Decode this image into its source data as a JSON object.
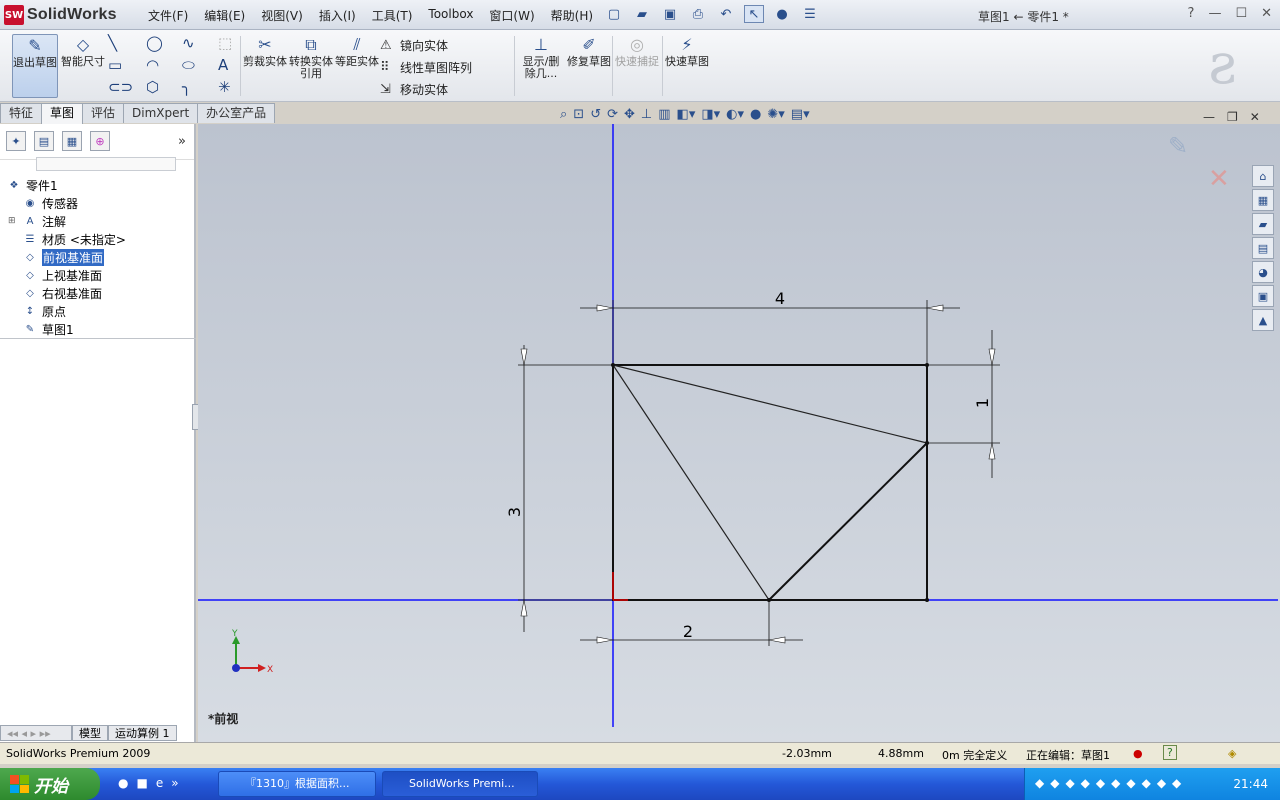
{
  "app": {
    "logo_text": "SolidWorks",
    "doc_title": "草图1 ← 零件1 *"
  },
  "menus": [
    "文件(F)",
    "编辑(E)",
    "视图(V)",
    "插入(I)",
    "工具(T)",
    "Toolbox",
    "窗口(W)",
    "帮助(H)"
  ],
  "title_right": {
    "help": "?",
    "minimize": "—",
    "restore": "☐",
    "close": "✕"
  },
  "commands": {
    "exit_sketch": "退出草图",
    "smart_dim": "智能尺寸",
    "trim": "剪裁实体",
    "convert": "转换实体引用",
    "offset": "等距实体",
    "mirror": "镜向实体",
    "linear_pattern": "线性草图阵列",
    "move": "移动实体",
    "show_delete": "显示/删除几...",
    "repair": "修复草图",
    "quick_snap": "快速捕捉",
    "rapid_sketch": "快速草图"
  },
  "tabs": [
    "特征",
    "草图",
    "评估",
    "DimXpert",
    "办公室产品"
  ],
  "active_tab": "草图",
  "tree": [
    {
      "label": "零件1",
      "icon": "part-icon"
    },
    {
      "label": "传感器",
      "icon": "sensor-icon"
    },
    {
      "label": "注解",
      "icon": "annotation-icon"
    },
    {
      "label": "材质 <未指定>",
      "icon": "material-icon"
    },
    {
      "label": "前视基准面",
      "icon": "plane-icon",
      "selected": true
    },
    {
      "label": "上视基准面",
      "icon": "plane-icon"
    },
    {
      "label": "右视基准面",
      "icon": "plane-icon"
    },
    {
      "label": "原点",
      "icon": "origin-icon"
    },
    {
      "label": "草图1",
      "icon": "sketch-icon"
    }
  ],
  "bottom_tabs": [
    "模型",
    "运动算例 1"
  ],
  "view_label": "*前视",
  "triad": {
    "x": "X",
    "y": "Y"
  },
  "dimensions": {
    "top": "4",
    "right": "1",
    "left": "3",
    "bottom": "2"
  },
  "status": {
    "product": "SolidWorks Premium 2009",
    "x": "-2.03mm",
    "y": "4.88mm",
    "z_def": "0m 完全定义",
    "editing": "正在编辑：草图1",
    "help": "?"
  },
  "taskbar": {
    "start": "开始",
    "window1": "『1310』根据面积...",
    "window2": "SolidWorks Premi...",
    "clock": "21:44"
  },
  "colors": {
    "axis_blue": "#1010ff",
    "origin_red": "#e00000",
    "selection_blue": "#316ac5"
  }
}
